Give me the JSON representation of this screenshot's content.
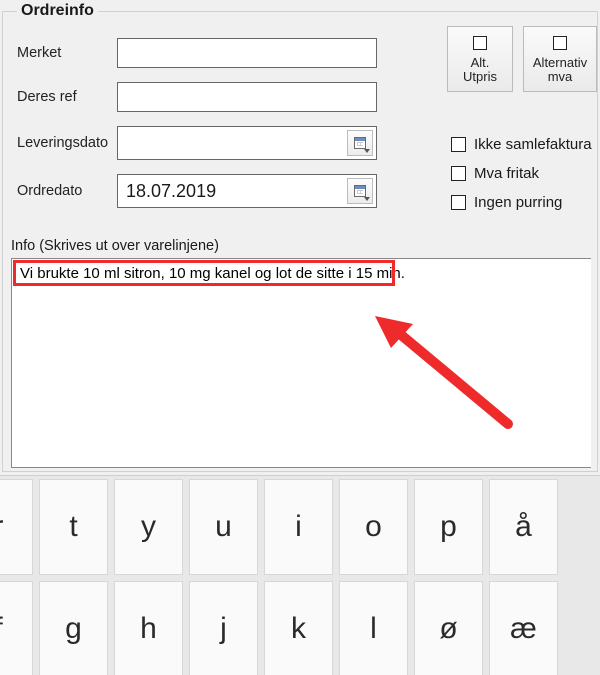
{
  "group": {
    "title": "Ordreinfo"
  },
  "labels": {
    "merket": "Merket",
    "deres_ref": "Deres ref",
    "leveringsdato": "Leveringsdato",
    "ordredato": "Ordredato",
    "info": "Info (Skrives ut over varelinjene)"
  },
  "fields": {
    "merket": "",
    "deres_ref": "",
    "leveringsdato": "",
    "ordredato": "18.07.2019",
    "info_text": "Vi brukte 10 ml sitron, 10 mg kanel og lot de sitte i 15 min."
  },
  "buttons": {
    "alt_utpris": {
      "line1": "Alt.",
      "line2": "Utpris"
    },
    "alt_mva": {
      "line1": "Alternativ",
      "line2": "mva"
    }
  },
  "checkboxes": {
    "ikke_samlefaktura": "Ikke samlefaktura",
    "mva_fritak": "Mva fritak",
    "ingen_purring": "Ingen purring"
  },
  "keyboard": {
    "row1": [
      "r",
      "t",
      "y",
      "u",
      "i",
      "o",
      "p",
      "å"
    ],
    "row2": [
      "f",
      "g",
      "h",
      "j",
      "k",
      "l",
      "ø",
      "æ"
    ]
  },
  "colors": {
    "highlight": "#ef2a2a"
  }
}
